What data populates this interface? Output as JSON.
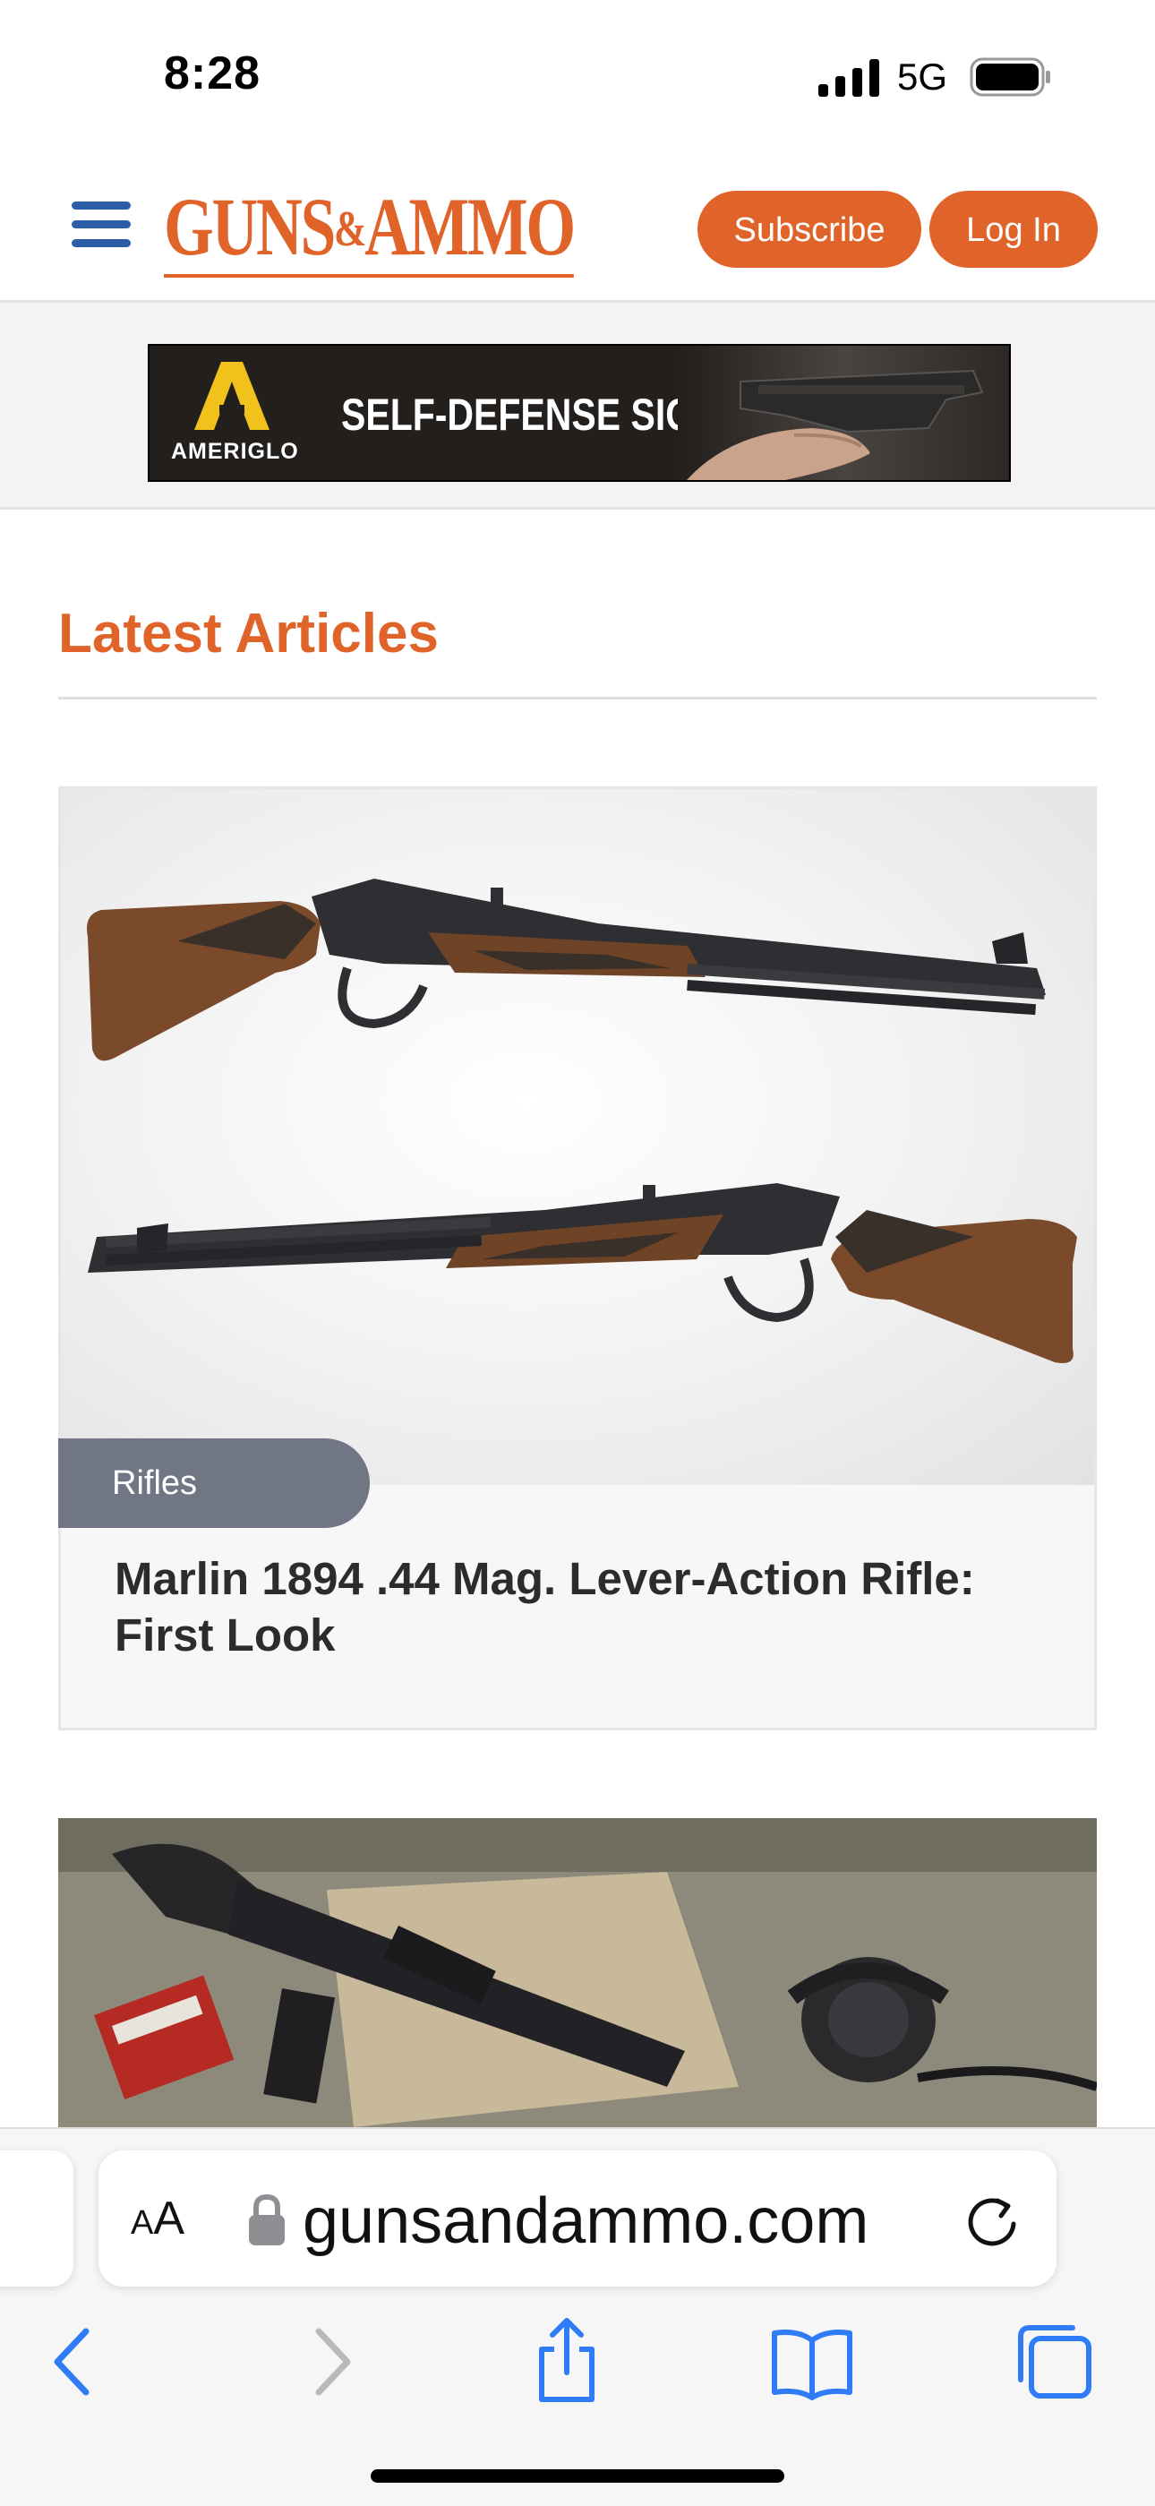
{
  "status_bar": {
    "time": "8:28",
    "network": "5G"
  },
  "header": {
    "logo_text_left": "GUNS",
    "logo_amp": "&",
    "logo_text_right": "AMMO",
    "subscribe_label": "Subscribe",
    "login_label": "Log In"
  },
  "ad": {
    "brand": "AMERIGLO",
    "headline": "SELF-DEFENSE SIGHTS"
  },
  "latest": {
    "section_title": "Latest Articles",
    "articles": [
      {
        "category": "Rifles",
        "title": "Marlin 1894 .44 Mag. Lever-Action Rifle: First Look"
      }
    ]
  },
  "browser": {
    "text_size_label_small": "A",
    "text_size_label_large": "A",
    "url": "gunsandammo.com"
  },
  "colors": {
    "brand_orange": "#e0642a",
    "menu_blue": "#2b5ea7",
    "tag_gray": "#717684",
    "ios_blue": "#2f7cf6"
  },
  "icons": {
    "menu": "hamburger-menu-icon",
    "lock": "lock-icon",
    "reload": "reload-icon",
    "back": "chevron-left-icon",
    "forward": "chevron-right-icon",
    "share": "share-icon",
    "bookmarks": "book-icon",
    "tabs": "tabs-icon"
  }
}
